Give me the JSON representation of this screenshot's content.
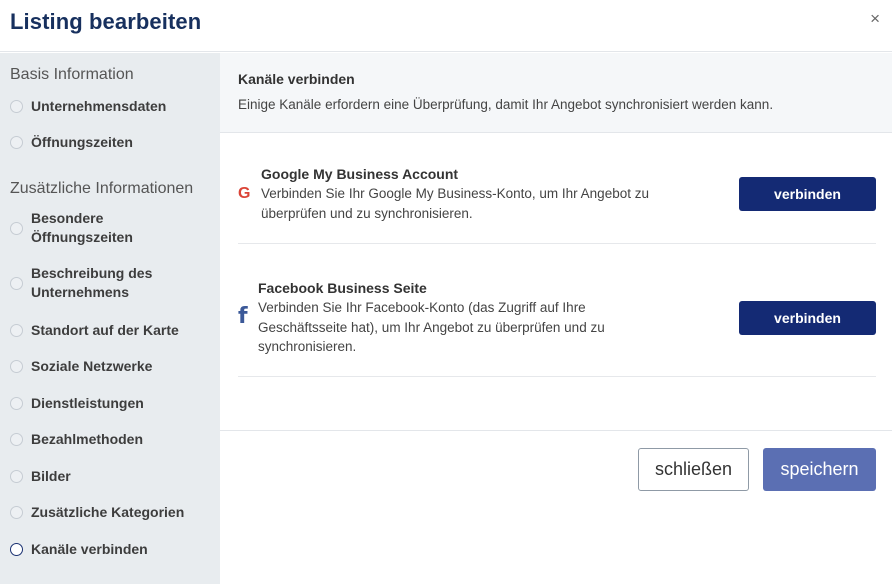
{
  "dialog": {
    "title": "Listing bearbeiten",
    "close_symbol": "×"
  },
  "sidebar": {
    "sections": [
      {
        "title": "Basis Information",
        "items": [
          {
            "label": "Unternehmensdaten",
            "active": false
          },
          {
            "label": "Öffnungszeiten",
            "active": false
          }
        ]
      },
      {
        "title": "Zusätzliche Informationen",
        "items": [
          {
            "label": "Besondere Öffnungszeiten",
            "active": false
          },
          {
            "label": "Beschreibung des Unternehmens",
            "active": false
          },
          {
            "label": "Standort auf der Karte",
            "active": false
          },
          {
            "label": "Soziale Netzwerke",
            "active": false
          },
          {
            "label": "Dienstleistungen",
            "active": false
          },
          {
            "label": "Bezahlmethoden",
            "active": false
          },
          {
            "label": "Bilder",
            "active": false
          },
          {
            "label": "Zusätzliche Kategorien",
            "active": false
          },
          {
            "label": "Kanäle verbinden",
            "active": true
          }
        ]
      }
    ]
  },
  "main": {
    "info": {
      "title": "Kanäle verbinden",
      "description": "Einige Kanäle erfordern eine Überprüfung, damit Ihr Angebot synchronisiert werden kann."
    },
    "channels": [
      {
        "icon": "google-icon",
        "icon_glyph": "G",
        "icon_color": "#db4437",
        "title": "Google My Business Account",
        "description": "Verbinden Sie Ihr Google My Business-Konto, um Ihr Angebot zu überprüfen und zu synchronisieren.",
        "button_label": "verbinden"
      },
      {
        "icon": "facebook-icon",
        "icon_glyph": "f",
        "icon_color": "#3b5998",
        "title": "Facebook Business Seite",
        "description": "Verbinden Sie Ihr Facebook-Konto (das Zugriff auf Ihre Geschäftsseite hat), um Ihr Angebot zu überprüfen und zu synchronisieren.",
        "button_label": "verbinden"
      }
    ]
  },
  "footer": {
    "close_label": "schließen",
    "save_label": "speichern"
  },
  "colors": {
    "title": "#17305e",
    "primary_button": "#142a74",
    "save_button": "#5b6fb3",
    "sidebar_bg": "#e8ecef"
  }
}
